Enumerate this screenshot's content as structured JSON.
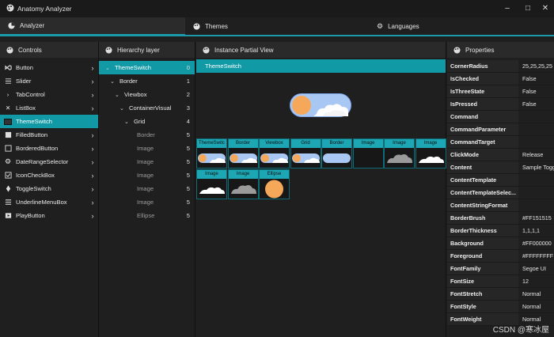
{
  "app": {
    "title": "Anatomy Analyzer"
  },
  "tabs": [
    {
      "label": "Analyzer",
      "icon": "pie-icon"
    },
    {
      "label": "Themes",
      "icon": "palette-icon"
    },
    {
      "label": "Languages",
      "icon": "gear-icon"
    }
  ],
  "controls": {
    "header": "Controls",
    "items": [
      {
        "label": "Button",
        "icon": "vs-icon"
      },
      {
        "label": "Slider",
        "icon": "slider-icon"
      },
      {
        "label": "TabControl",
        "icon": "tab-icon"
      },
      {
        "label": "ListBox",
        "icon": "close-icon"
      },
      {
        "label": "ThemeSwitch",
        "icon": "theme-icon"
      },
      {
        "label": "FilledButton",
        "icon": "filled-button-icon"
      },
      {
        "label": "BorderedButton",
        "icon": "bordered-button-icon"
      },
      {
        "label": "DateRangeSelector",
        "icon": "gear-icon"
      },
      {
        "label": "IconCheckBox",
        "icon": "checkbox-icon"
      },
      {
        "label": "ToggleSwitch",
        "icon": "diamond-icon"
      },
      {
        "label": "UnderlineMenuBox",
        "icon": "menu-icon"
      },
      {
        "label": "PlayButton",
        "icon": "play-icon"
      }
    ]
  },
  "hierarchy": {
    "header": "Hierarchy layer",
    "rows": [
      {
        "label": "ThemeSwitch",
        "num": "0"
      },
      {
        "label": "Border",
        "num": "1"
      },
      {
        "label": "Viewbox",
        "num": "2"
      },
      {
        "label": "ContainerVisual",
        "num": "3"
      },
      {
        "label": "Grid",
        "num": "4"
      },
      {
        "label": "Border",
        "num": "5"
      },
      {
        "label": "Image",
        "num": "5"
      },
      {
        "label": "Image",
        "num": "5"
      },
      {
        "label": "Image",
        "num": "5"
      },
      {
        "label": "Image",
        "num": "5"
      },
      {
        "label": "Image",
        "num": "5"
      },
      {
        "label": "Ellipse",
        "num": "5"
      }
    ]
  },
  "instance": {
    "header": "Instance Partial View",
    "selected": "ThemeSwitch",
    "cells": [
      "ThemeSwitc",
      "Border",
      "Viewbox",
      "Grid",
      "Border",
      "Image",
      "Image",
      "Image",
      "Image",
      "Image",
      "Ellipse"
    ]
  },
  "properties": {
    "header": "Properties",
    "rows": [
      {
        "name": "CornerRadius",
        "value": "25,25,25,25"
      },
      {
        "name": "IsChecked",
        "value": "False"
      },
      {
        "name": "IsThreeState",
        "value": "False"
      },
      {
        "name": "IsPressed",
        "value": "False"
      },
      {
        "name": "Command",
        "value": ""
      },
      {
        "name": "CommandParameter",
        "value": ""
      },
      {
        "name": "CommandTarget",
        "value": ""
      },
      {
        "name": "ClickMode",
        "value": "Release"
      },
      {
        "name": "Content",
        "value": "Sample Toggle"
      },
      {
        "name": "ContentTemplate",
        "value": ""
      },
      {
        "name": "ContentTemplateSelec...",
        "value": ""
      },
      {
        "name": "ContentStringFormat",
        "value": ""
      },
      {
        "name": "BorderBrush",
        "value": "#FF151515"
      },
      {
        "name": "BorderThickness",
        "value": "1,1,1,1"
      },
      {
        "name": "Background",
        "value": "#FF000000"
      },
      {
        "name": "Foreground",
        "value": "#FFFFFFFF"
      },
      {
        "name": "FontFamily",
        "value": "Segoe UI"
      },
      {
        "name": "FontSize",
        "value": "12"
      },
      {
        "name": "FontStretch",
        "value": "Normal"
      },
      {
        "name": "FontStyle",
        "value": "Normal"
      },
      {
        "name": "FontWeight",
        "value": "Normal"
      }
    ]
  },
  "watermark": "CSDN @寒冰屋",
  "colors": {
    "accent": "#119aa6",
    "sun": "#f6a85a",
    "sky": "#8fb8f0"
  }
}
